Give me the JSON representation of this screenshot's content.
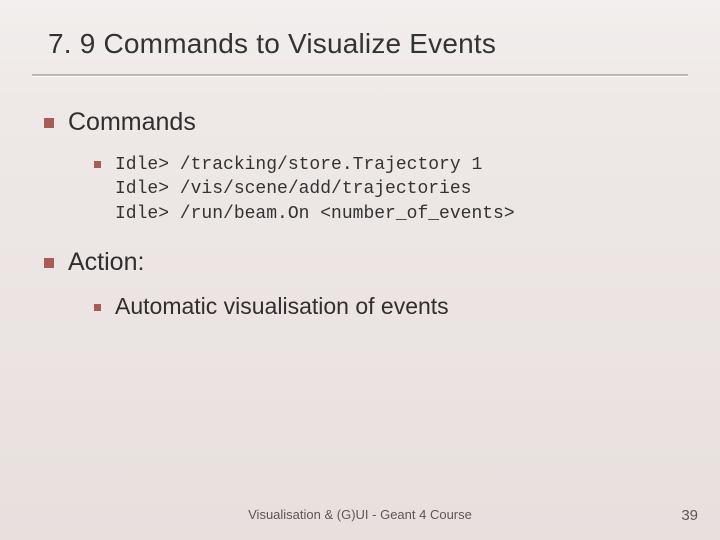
{
  "title": "7. 9 Commands to Visualize Events",
  "sections": [
    {
      "heading": "Commands",
      "code": "Idle> /tracking/store.Trajectory 1\nIdle> /vis/scene/add/trajectories\nIdle> /run/beam.On <number_of_events>"
    },
    {
      "heading": "Action:",
      "sub": "Automatic visualisation of events"
    }
  ],
  "footer": "Visualisation & (G)UI - Geant 4 Course",
  "page": "39"
}
